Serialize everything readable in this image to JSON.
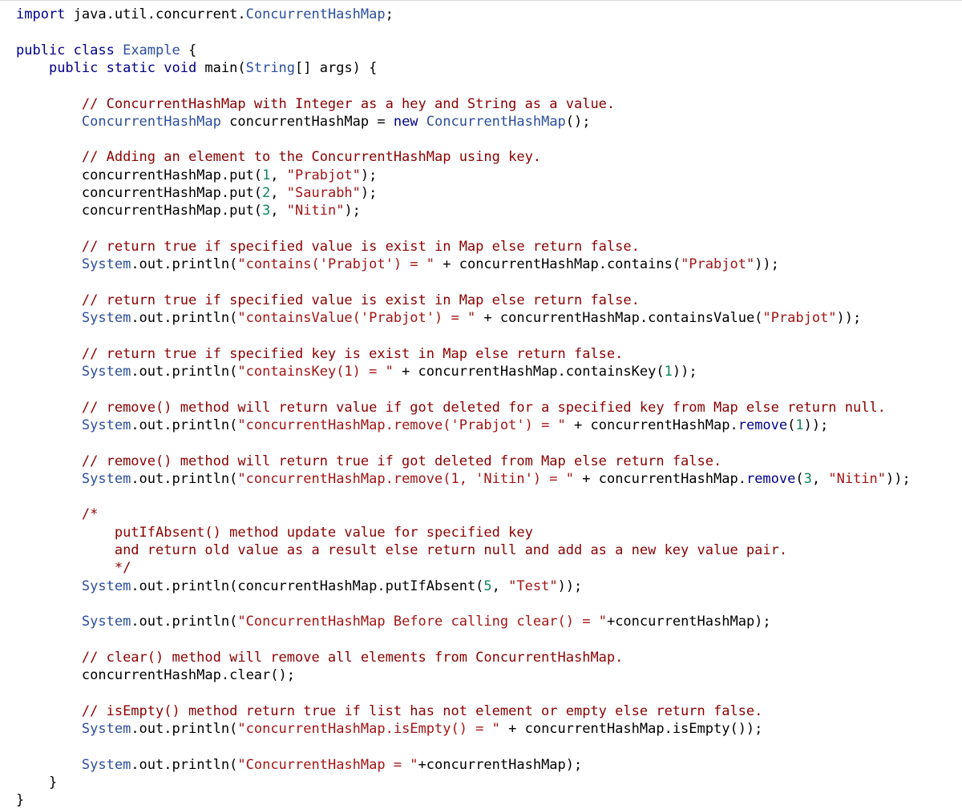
{
  "editor": {
    "language": "java",
    "colors": {
      "plain": "#000000",
      "keyword": "#00008b",
      "type": "#2b4e9e",
      "string": "#a31515",
      "comment": "#8b0000",
      "number": "#098658",
      "background": "#ffffff"
    },
    "lines": [
      [
        {
          "t": "kw",
          "v": "import"
        },
        {
          "t": "plain",
          "v": " java.util.concurrent."
        },
        {
          "t": "type",
          "v": "ConcurrentHashMap"
        },
        {
          "t": "plain",
          "v": ";"
        }
      ],
      [],
      [
        {
          "t": "kw",
          "v": "public class"
        },
        {
          "t": "plain",
          "v": " "
        },
        {
          "t": "type",
          "v": "Example"
        },
        {
          "t": "plain",
          "v": " {"
        }
      ],
      [
        {
          "t": "plain",
          "v": "    "
        },
        {
          "t": "kw",
          "v": "public static void"
        },
        {
          "t": "plain",
          "v": " main("
        },
        {
          "t": "type",
          "v": "String"
        },
        {
          "t": "plain",
          "v": "[] args) {"
        }
      ],
      [],
      [
        {
          "t": "plain",
          "v": "        "
        },
        {
          "t": "com",
          "v": "// ConcurrentHashMap with Integer as a hey and String as a value."
        }
      ],
      [
        {
          "t": "plain",
          "v": "        "
        },
        {
          "t": "type",
          "v": "ConcurrentHashMap"
        },
        {
          "t": "plain",
          "v": " concurrentHashMap = "
        },
        {
          "t": "kw",
          "v": "new"
        },
        {
          "t": "plain",
          "v": " "
        },
        {
          "t": "type",
          "v": "ConcurrentHashMap"
        },
        {
          "t": "plain",
          "v": "();"
        }
      ],
      [],
      [
        {
          "t": "plain",
          "v": "        "
        },
        {
          "t": "com",
          "v": "// Adding an element to the ConcurrentHashMap using key."
        }
      ],
      [
        {
          "t": "plain",
          "v": "        concurrentHashMap.put("
        },
        {
          "t": "num",
          "v": "1"
        },
        {
          "t": "plain",
          "v": ", "
        },
        {
          "t": "str",
          "v": "\"Prabjot\""
        },
        {
          "t": "plain",
          "v": ");"
        }
      ],
      [
        {
          "t": "plain",
          "v": "        concurrentHashMap.put("
        },
        {
          "t": "num",
          "v": "2"
        },
        {
          "t": "plain",
          "v": ", "
        },
        {
          "t": "str",
          "v": "\"Saurabh\""
        },
        {
          "t": "plain",
          "v": ");"
        }
      ],
      [
        {
          "t": "plain",
          "v": "        concurrentHashMap.put("
        },
        {
          "t": "num",
          "v": "3"
        },
        {
          "t": "plain",
          "v": ", "
        },
        {
          "t": "str",
          "v": "\"Nitin\""
        },
        {
          "t": "plain",
          "v": ");"
        }
      ],
      [],
      [
        {
          "t": "plain",
          "v": "        "
        },
        {
          "t": "com",
          "v": "// return true if specified value is exist in Map else return false."
        }
      ],
      [
        {
          "t": "plain",
          "v": "        "
        },
        {
          "t": "type",
          "v": "System"
        },
        {
          "t": "plain",
          "v": ".out.println("
        },
        {
          "t": "str",
          "v": "\"contains('Prabjot') = \""
        },
        {
          "t": "plain",
          "v": " + concurrentHashMap.contains("
        },
        {
          "t": "str",
          "v": "\"Prabjot\""
        },
        {
          "t": "plain",
          "v": "));"
        }
      ],
      [],
      [
        {
          "t": "plain",
          "v": "        "
        },
        {
          "t": "com",
          "v": "// return true if specified value is exist in Map else return false."
        }
      ],
      [
        {
          "t": "plain",
          "v": "        "
        },
        {
          "t": "type",
          "v": "System"
        },
        {
          "t": "plain",
          "v": ".out.println("
        },
        {
          "t": "str",
          "v": "\"containsValue('Prabjot') = \""
        },
        {
          "t": "plain",
          "v": " + concurrentHashMap.containsValue("
        },
        {
          "t": "str",
          "v": "\"Prabjot\""
        },
        {
          "t": "plain",
          "v": "));"
        }
      ],
      [],
      [
        {
          "t": "plain",
          "v": "        "
        },
        {
          "t": "com",
          "v": "// return true if specified key is exist in Map else return false."
        }
      ],
      [
        {
          "t": "plain",
          "v": "        "
        },
        {
          "t": "type",
          "v": "System"
        },
        {
          "t": "plain",
          "v": ".out.println("
        },
        {
          "t": "str",
          "v": "\"containsKey(1) = \""
        },
        {
          "t": "plain",
          "v": " + concurrentHashMap.containsKey("
        },
        {
          "t": "num",
          "v": "1"
        },
        {
          "t": "plain",
          "v": "));"
        }
      ],
      [],
      [
        {
          "t": "plain",
          "v": "        "
        },
        {
          "t": "com",
          "v": "// remove() method will return value if got deleted for a specified key from Map else return null."
        }
      ],
      [
        {
          "t": "plain",
          "v": "        "
        },
        {
          "t": "type",
          "v": "System"
        },
        {
          "t": "plain",
          "v": ".out.println("
        },
        {
          "t": "str",
          "v": "\"concurrentHashMap.remove('Prabjot') = \""
        },
        {
          "t": "plain",
          "v": " + concurrentHashMap."
        },
        {
          "t": "kw",
          "v": "remove"
        },
        {
          "t": "plain",
          "v": "("
        },
        {
          "t": "num",
          "v": "1"
        },
        {
          "t": "plain",
          "v": "));"
        }
      ],
      [],
      [
        {
          "t": "plain",
          "v": "        "
        },
        {
          "t": "com",
          "v": "// remove() method will return true if got deleted from Map else return false."
        }
      ],
      [
        {
          "t": "plain",
          "v": "        "
        },
        {
          "t": "type",
          "v": "System"
        },
        {
          "t": "plain",
          "v": ".out.println("
        },
        {
          "t": "str",
          "v": "\"concurrentHashMap.remove(1, 'Nitin') = \""
        },
        {
          "t": "plain",
          "v": " + concurrentHashMap."
        },
        {
          "t": "kw",
          "v": "remove"
        },
        {
          "t": "plain",
          "v": "("
        },
        {
          "t": "num",
          "v": "3"
        },
        {
          "t": "plain",
          "v": ", "
        },
        {
          "t": "str",
          "v": "\"Nitin\""
        },
        {
          "t": "plain",
          "v": "));"
        }
      ],
      [],
      [
        {
          "t": "plain",
          "v": "        "
        },
        {
          "t": "com",
          "v": "/*"
        }
      ],
      [
        {
          "t": "plain",
          "v": "            "
        },
        {
          "t": "com",
          "v": "putIfAbsent() method update value for specified key"
        }
      ],
      [
        {
          "t": "plain",
          "v": "            "
        },
        {
          "t": "com",
          "v": "and return old value as a result else return null and add as a new key value pair."
        }
      ],
      [
        {
          "t": "plain",
          "v": "            "
        },
        {
          "t": "com",
          "v": "*/"
        }
      ],
      [
        {
          "t": "plain",
          "v": "        "
        },
        {
          "t": "type",
          "v": "System"
        },
        {
          "t": "plain",
          "v": ".out.println(concurrentHashMap.putIfAbsent("
        },
        {
          "t": "num",
          "v": "5"
        },
        {
          "t": "plain",
          "v": ", "
        },
        {
          "t": "str",
          "v": "\"Test\""
        },
        {
          "t": "plain",
          "v": "));"
        }
      ],
      [],
      [
        {
          "t": "plain",
          "v": "        "
        },
        {
          "t": "type",
          "v": "System"
        },
        {
          "t": "plain",
          "v": ".out.println("
        },
        {
          "t": "str",
          "v": "\"ConcurrentHashMap Before calling clear() = \""
        },
        {
          "t": "plain",
          "v": "+concurrentHashMap);"
        }
      ],
      [],
      [
        {
          "t": "plain",
          "v": "        "
        },
        {
          "t": "com",
          "v": "// clear() method will remove all elements from ConcurrentHashMap."
        }
      ],
      [
        {
          "t": "plain",
          "v": "        concurrentHashMap.clear();"
        }
      ],
      [],
      [
        {
          "t": "plain",
          "v": "        "
        },
        {
          "t": "com",
          "v": "// isEmpty() method return true if list has not element or empty else return false."
        }
      ],
      [
        {
          "t": "plain",
          "v": "        "
        },
        {
          "t": "type",
          "v": "System"
        },
        {
          "t": "plain",
          "v": ".out.println("
        },
        {
          "t": "str",
          "v": "\"concurrentHashMap.isEmpty() = \""
        },
        {
          "t": "plain",
          "v": " + concurrentHashMap.isEmpty());"
        }
      ],
      [],
      [
        {
          "t": "plain",
          "v": "        "
        },
        {
          "t": "type",
          "v": "System"
        },
        {
          "t": "plain",
          "v": ".out.println("
        },
        {
          "t": "str",
          "v": "\"ConcurrentHashMap = \""
        },
        {
          "t": "plain",
          "v": "+concurrentHashMap);"
        }
      ],
      [
        {
          "t": "plain",
          "v": "    }"
        }
      ],
      [
        {
          "t": "plain",
          "v": "}"
        }
      ]
    ]
  }
}
